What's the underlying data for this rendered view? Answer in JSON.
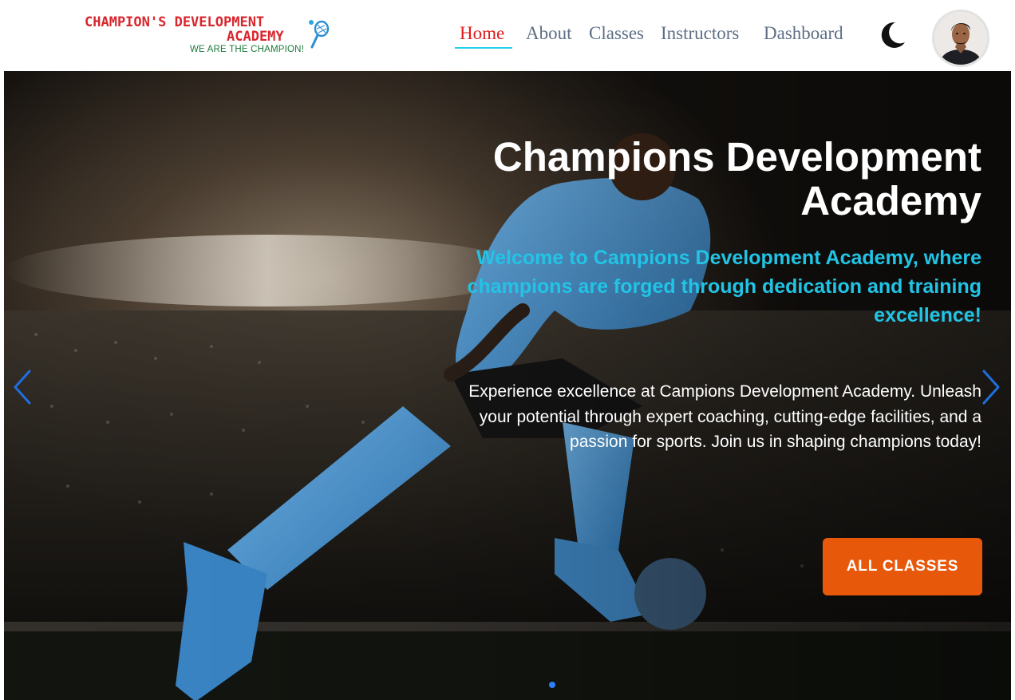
{
  "brand": {
    "line1": "CHAMPION'S DEVELOPMENT",
    "line2": "ACADEMY",
    "tagline": "WE ARE THE CHAMPION!",
    "logo_icon": "tennis-racket-icon",
    "name_color": "#d8262d",
    "tagline_color": "#1a7a3a"
  },
  "nav": {
    "items": [
      {
        "label": "Home",
        "active": true
      },
      {
        "label": "About",
        "active": false
      },
      {
        "label": "Classes",
        "active": false
      },
      {
        "label": "Instructors",
        "active": false
      },
      {
        "label": "Dashboard",
        "active": false
      }
    ],
    "active_color": "#e01b1b",
    "text_color": "#5d6e86",
    "underline_color": "#22d3ee"
  },
  "header_icons": {
    "theme_toggle": "moon-icon",
    "profile": "user-avatar"
  },
  "hero": {
    "title": "Champions Development Academy",
    "subtitle": "Welcome to Campions Development Academy, where champions are forged through dedication and training excellence!",
    "body": "Experience excellence at Campions Development Academy. Unleash your potential through expert coaching, cutting-edge facilities, and a passion for sports. Join us in shaping champions today!",
    "button_label": "ALL CLASSES",
    "button_color": "#e8580b",
    "subtitle_color": "#22c4e6",
    "prev_icon": "chevron-left-icon",
    "next_icon": "chevron-right-icon",
    "slide_count": 1,
    "active_slide": 1
  }
}
